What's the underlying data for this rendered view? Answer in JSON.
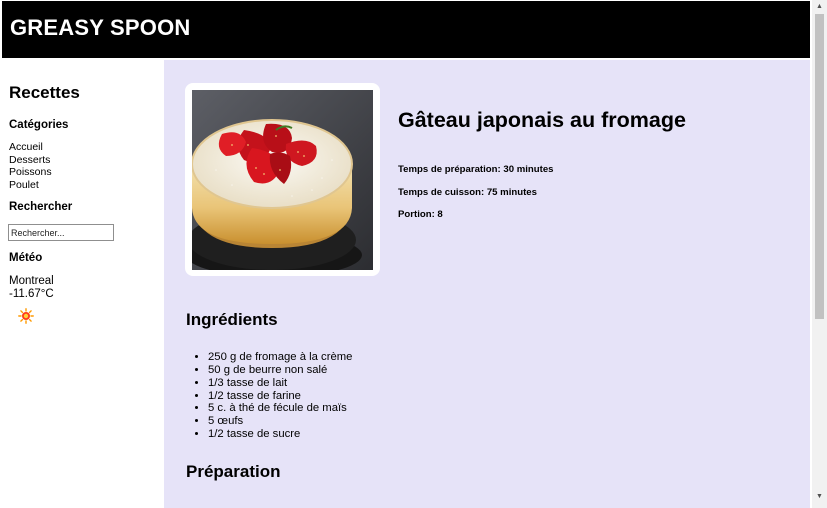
{
  "header": {
    "site_title": "GREASY SPOON"
  },
  "sidebar": {
    "heading": "Recettes",
    "categories_heading": "Catégories",
    "categories": [
      "Accueil",
      "Desserts",
      "Poissons",
      "Poulet"
    ],
    "search_heading": "Rechercher",
    "search_placeholder": "Rechercher...",
    "weather_heading": "Météo",
    "weather_city": "Montreal",
    "weather_temp": "-11.67°C",
    "weather_icon": "sun-icon"
  },
  "recipe": {
    "title": "Gâteau japonais au fromage",
    "prep_time": "Temps de préparation: 30 minutes",
    "cook_time": "Temps de cuisson: 75 minutes",
    "servings": "Portion: 8",
    "ingredients_heading": "Ingrédients",
    "ingredients": [
      "250 g de fromage à la crème",
      "50 g de beurre non salé",
      "1/3 tasse de lait",
      "1/2 tasse de farine",
      "5 c. à thé de fécule de maïs",
      "5 œufs",
      "1/2 tasse de sucre"
    ],
    "preparation_heading": "Préparation"
  },
  "colors": {
    "header_bg": "#000000",
    "main_bg": "#e6e3f8",
    "sun": "#ffb400"
  }
}
